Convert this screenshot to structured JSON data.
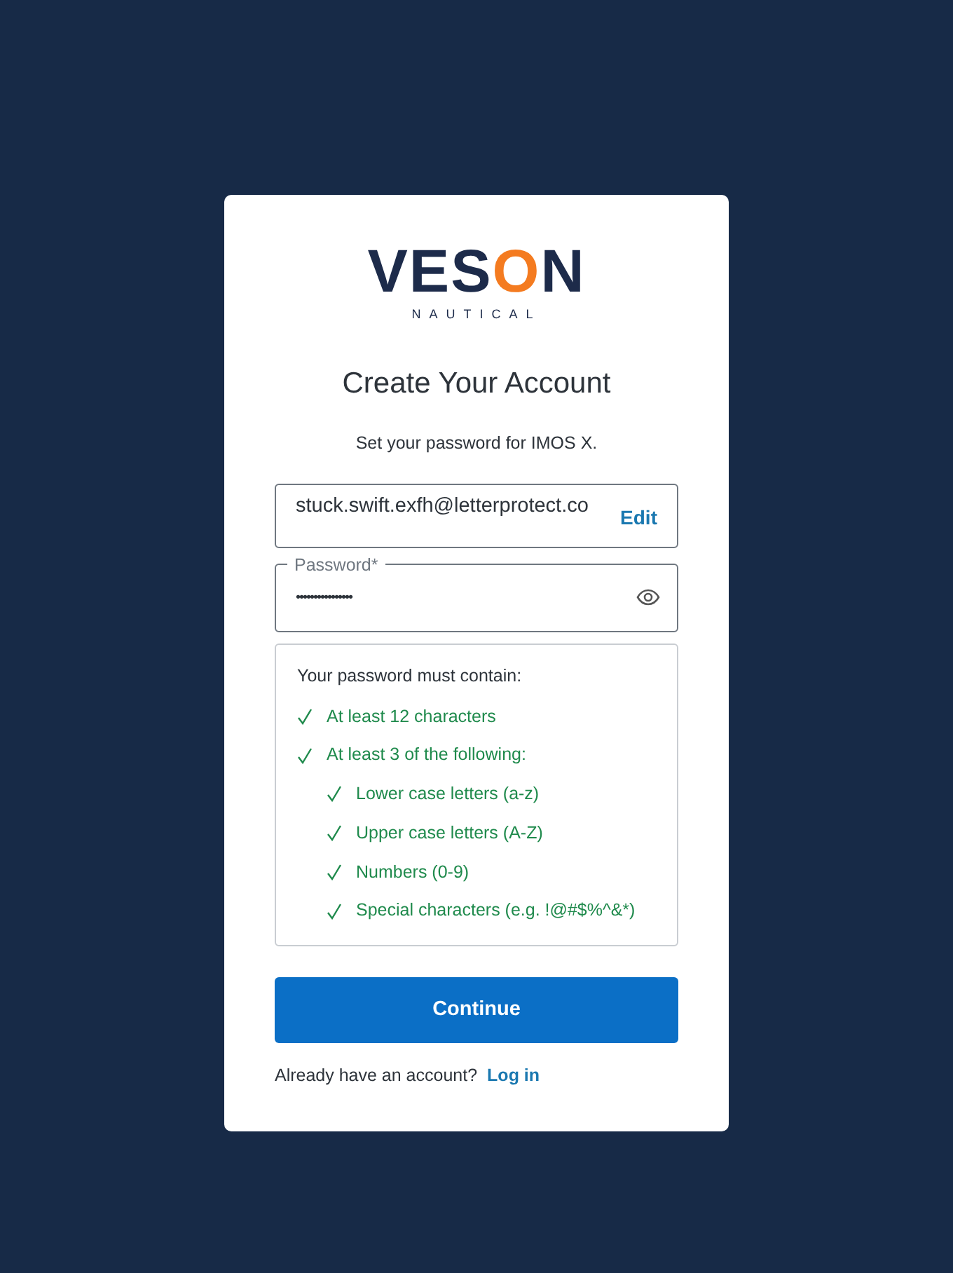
{
  "logo": {
    "word": "VESON",
    "subtitle": "NAUTICAL"
  },
  "title": "Create Your Account",
  "subtitle": "Set your password for IMOS X.",
  "email": {
    "value": "stuck.swift.exfh@letterprotect.co",
    "action": "Edit"
  },
  "password": {
    "label": "Password*",
    "value": "••••••••••••••••"
  },
  "requirements": {
    "heading": "Your password must contain:",
    "items": [
      {
        "text": "At least 12 characters",
        "met": true
      },
      {
        "text": "At least 3 of the following:",
        "met": true,
        "children": [
          {
            "text": "Lower case letters (a-z)",
            "met": true
          },
          {
            "text": "Upper case letters (A-Z)",
            "met": true
          },
          {
            "text": "Numbers (0-9)",
            "met": true
          },
          {
            "text": "Special characters (e.g. !@#$%^&*)",
            "met": true
          }
        ]
      }
    ]
  },
  "continue_button": "Continue",
  "footer": {
    "text": "Already have an account?",
    "link": "Log in"
  }
}
